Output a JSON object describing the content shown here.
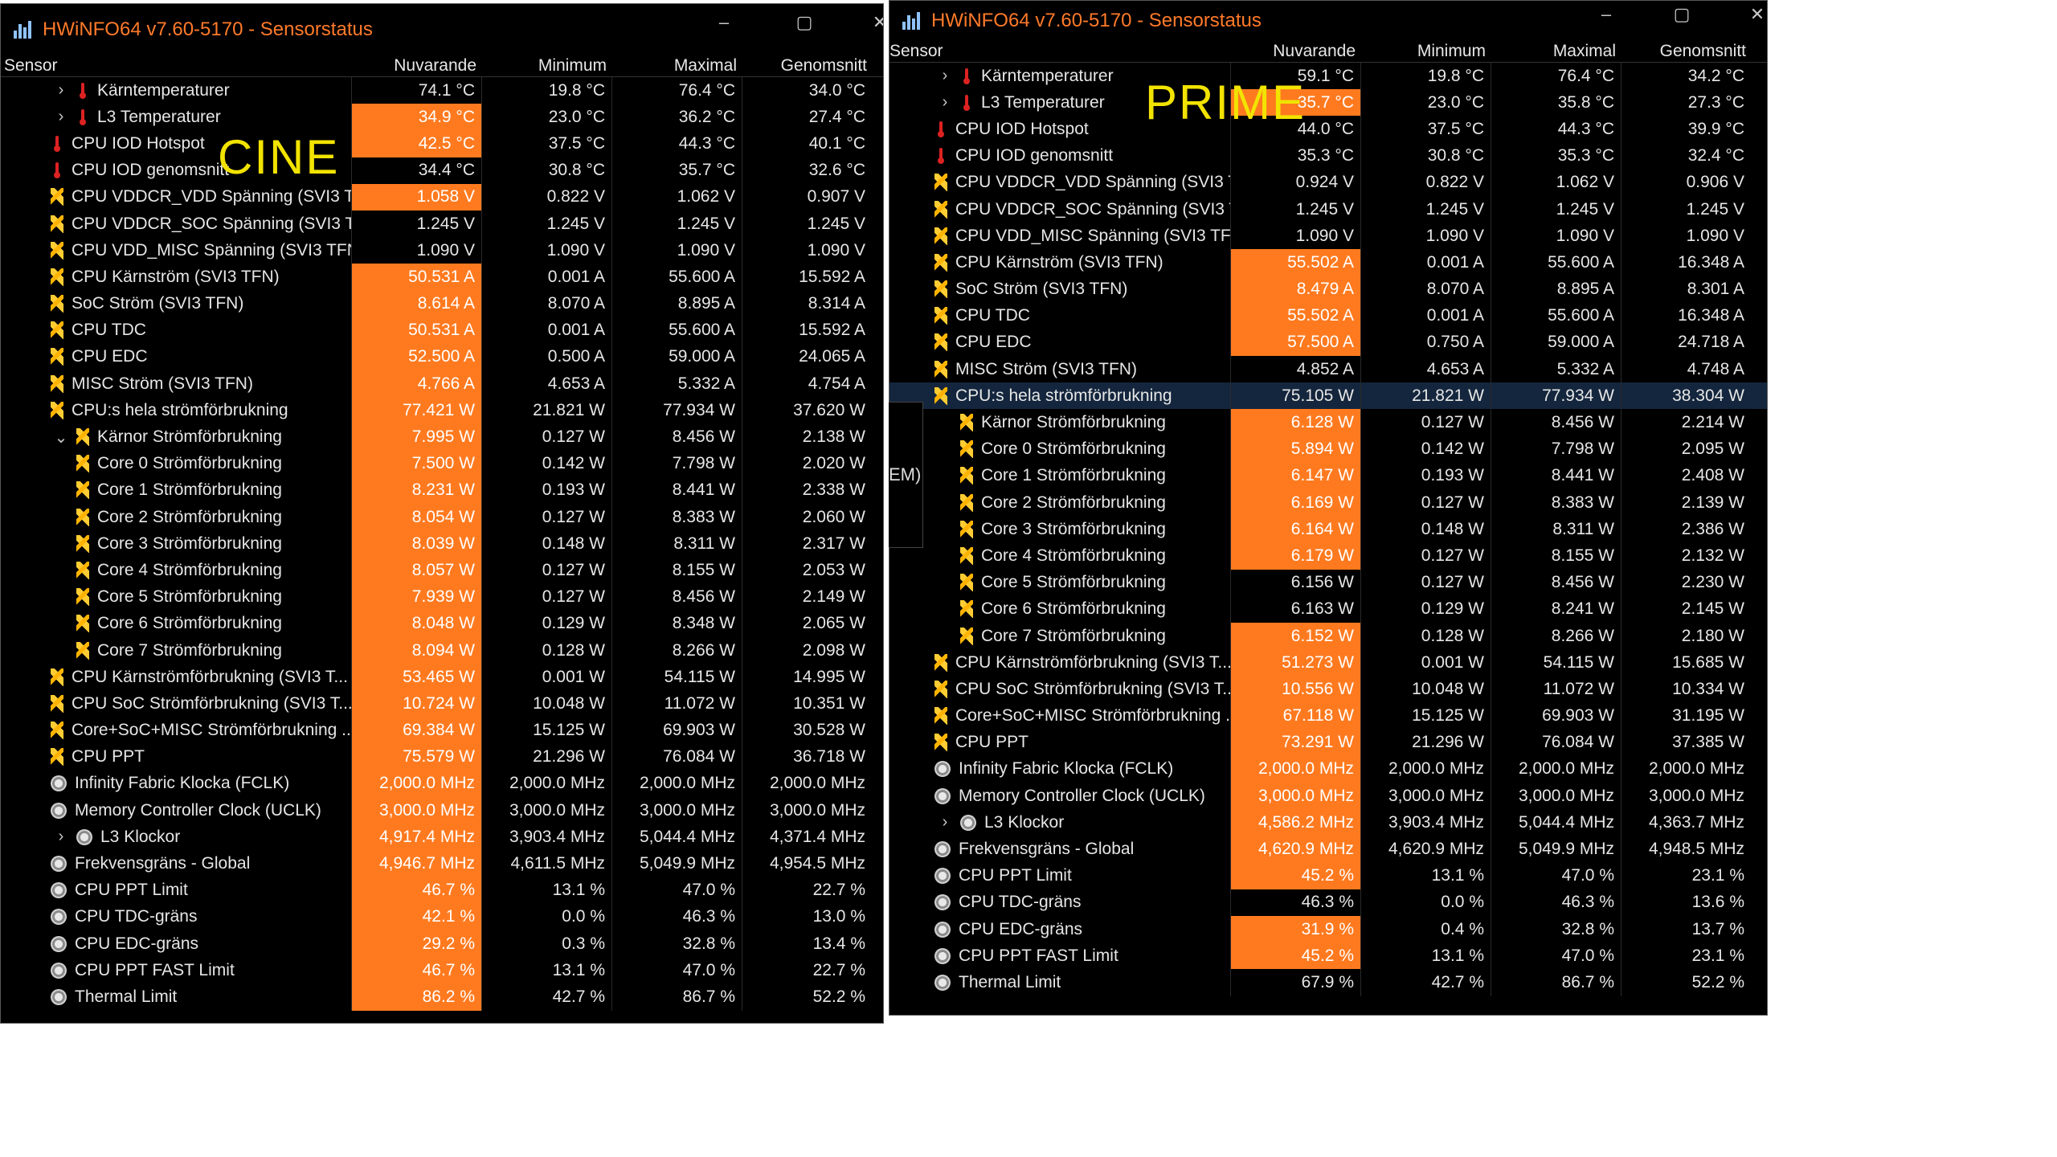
{
  "left": {
    "title": "HWiNFO64 v7.60-5170 - Sensorstatus",
    "overlay": "CINE",
    "headers": [
      "Sensor",
      "Nuvarande",
      "Minimum",
      "Maximal",
      "Genomsnitt"
    ],
    "rows": [
      {
        "n": "Kärntemperaturer",
        "i": "temp",
        "l": 1,
        "ch": ">",
        "v": [
          "74.1 °C",
          "19.8 °C",
          "76.4 °C",
          "34.0 °C"
        ],
        "h": false
      },
      {
        "n": "L3 Temperaturer",
        "i": "temp",
        "l": 1,
        "ch": ">",
        "v": [
          "34.9 °C",
          "23.0 °C",
          "36.2 °C",
          "27.4 °C"
        ],
        "h": true
      },
      {
        "n": "CPU IOD Hotspot",
        "i": "temp",
        "l": 0,
        "v": [
          "42.5 °C",
          "37.5 °C",
          "44.3 °C",
          "40.1 °C"
        ],
        "h": true
      },
      {
        "n": "CPU IOD genomsnitt",
        "i": "temp",
        "l": 0,
        "v": [
          "34.4 °C",
          "30.8 °C",
          "35.7 °C",
          "32.6 °C"
        ],
        "h": false
      },
      {
        "n": "CPU VDDCR_VDD Spänning (SVI3 T...",
        "i": "bolt",
        "l": 0,
        "v": [
          "1.058 V",
          "0.822 V",
          "1.062 V",
          "0.907 V"
        ],
        "h": true
      },
      {
        "n": "CPU VDDCR_SOC Spänning (SVI3 T...",
        "i": "bolt",
        "l": 0,
        "v": [
          "1.245 V",
          "1.245 V",
          "1.245 V",
          "1.245 V"
        ],
        "h": false
      },
      {
        "n": "CPU VDD_MISC Spänning (SVI3 TFN)",
        "i": "bolt",
        "l": 0,
        "v": [
          "1.090 V",
          "1.090 V",
          "1.090 V",
          "1.090 V"
        ],
        "h": false
      },
      {
        "n": "CPU Kärnström (SVI3 TFN)",
        "i": "bolt",
        "l": 0,
        "v": [
          "50.531 A",
          "0.001 A",
          "55.600 A",
          "15.592 A"
        ],
        "h": true
      },
      {
        "n": "SoC Ström (SVI3 TFN)",
        "i": "bolt",
        "l": 0,
        "v": [
          "8.614 A",
          "8.070 A",
          "8.895 A",
          "8.314 A"
        ],
        "h": true
      },
      {
        "n": "CPU TDC",
        "i": "bolt",
        "l": 0,
        "v": [
          "50.531 A",
          "0.001 A",
          "55.600 A",
          "15.592 A"
        ],
        "h": true
      },
      {
        "n": "CPU EDC",
        "i": "bolt",
        "l": 0,
        "v": [
          "52.500 A",
          "0.500 A",
          "59.000 A",
          "24.065 A"
        ],
        "h": true
      },
      {
        "n": "MISC Ström (SVI3 TFN)",
        "i": "bolt",
        "l": 0,
        "v": [
          "4.766 A",
          "4.653 A",
          "5.332 A",
          "4.754 A"
        ],
        "h": true
      },
      {
        "n": "CPU:s hela strömförbrukning",
        "i": "bolt",
        "l": 0,
        "v": [
          "77.421 W",
          "21.821 W",
          "77.934 W",
          "37.620 W"
        ],
        "h": true
      },
      {
        "n": "Kärnor Strömförbrukning",
        "i": "bolt",
        "l": 1,
        "ch": "v",
        "v": [
          "7.995 W",
          "0.127 W",
          "8.456 W",
          "2.138 W"
        ],
        "h": true
      },
      {
        "n": "Core 0 Strömförbrukning",
        "i": "bolt",
        "l": 1,
        "v": [
          "7.500 W",
          "0.142 W",
          "7.798 W",
          "2.020 W"
        ],
        "h": true
      },
      {
        "n": "Core 1 Strömförbrukning",
        "i": "bolt",
        "l": 1,
        "v": [
          "8.231 W",
          "0.193 W",
          "8.441 W",
          "2.338 W"
        ],
        "h": true
      },
      {
        "n": "Core 2 Strömförbrukning",
        "i": "bolt",
        "l": 1,
        "v": [
          "8.054 W",
          "0.127 W",
          "8.383 W",
          "2.060 W"
        ],
        "h": true
      },
      {
        "n": "Core 3 Strömförbrukning",
        "i": "bolt",
        "l": 1,
        "v": [
          "8.039 W",
          "0.148 W",
          "8.311 W",
          "2.317 W"
        ],
        "h": true
      },
      {
        "n": "Core 4 Strömförbrukning",
        "i": "bolt",
        "l": 1,
        "v": [
          "8.057 W",
          "0.127 W",
          "8.155 W",
          "2.053 W"
        ],
        "h": true
      },
      {
        "n": "Core 5 Strömförbrukning",
        "i": "bolt",
        "l": 1,
        "v": [
          "7.939 W",
          "0.127 W",
          "8.456 W",
          "2.149 W"
        ],
        "h": true
      },
      {
        "n": "Core 6 Strömförbrukning",
        "i": "bolt",
        "l": 1,
        "v": [
          "8.048 W",
          "0.129 W",
          "8.348 W",
          "2.065 W"
        ],
        "h": true
      },
      {
        "n": "Core 7 Strömförbrukning",
        "i": "bolt",
        "l": 1,
        "v": [
          "8.094 W",
          "0.128 W",
          "8.266 W",
          "2.098 W"
        ],
        "h": true
      },
      {
        "n": "CPU Kärnströmförbrukning (SVI3 T...",
        "i": "bolt",
        "l": 0,
        "v": [
          "53.465 W",
          "0.001 W",
          "54.115 W",
          "14.995 W"
        ],
        "h": true
      },
      {
        "n": "CPU SoC Strömförbrukning (SVI3 T...",
        "i": "bolt",
        "l": 0,
        "v": [
          "10.724 W",
          "10.048 W",
          "11.072 W",
          "10.351 W"
        ],
        "h": true
      },
      {
        "n": "Core+SoC+MISC Strömförbrukning ...",
        "i": "bolt",
        "l": 0,
        "v": [
          "69.384 W",
          "15.125 W",
          "69.903 W",
          "30.528 W"
        ],
        "h": true
      },
      {
        "n": "CPU PPT",
        "i": "bolt",
        "l": 0,
        "v": [
          "75.579 W",
          "21.296 W",
          "76.084 W",
          "36.718 W"
        ],
        "h": true
      },
      {
        "n": "Infinity Fabric Klocka (FCLK)",
        "i": "clock",
        "l": 0,
        "v": [
          "2,000.0 MHz",
          "2,000.0 MHz",
          "2,000.0 MHz",
          "2,000.0 MHz"
        ],
        "h": true
      },
      {
        "n": "Memory Controller Clock (UCLK)",
        "i": "clock",
        "l": 0,
        "v": [
          "3,000.0 MHz",
          "3,000.0 MHz",
          "3,000.0 MHz",
          "3,000.0 MHz"
        ],
        "h": true
      },
      {
        "n": "L3 Klockor",
        "i": "clock",
        "l": 1,
        "ch": ">",
        "v": [
          "4,917.4 MHz",
          "3,903.4 MHz",
          "5,044.4 MHz",
          "4,371.4 MHz"
        ],
        "h": true
      },
      {
        "n": "Frekvensgräns - Global",
        "i": "clock",
        "l": 0,
        "v": [
          "4,946.7 MHz",
          "4,611.5 MHz",
          "5,049.9 MHz",
          "4,954.5 MHz"
        ],
        "h": true
      },
      {
        "n": "CPU PPT Limit",
        "i": "clock",
        "l": 0,
        "v": [
          "46.7 %",
          "13.1 %",
          "47.0 %",
          "22.7 %"
        ],
        "h": true
      },
      {
        "n": "CPU TDC-gräns",
        "i": "clock",
        "l": 0,
        "v": [
          "42.1 %",
          "0.0 %",
          "46.3 %",
          "13.0 %"
        ],
        "h": true
      },
      {
        "n": "CPU EDC-gräns",
        "i": "clock",
        "l": 0,
        "v": [
          "29.2 %",
          "0.3 %",
          "32.8 %",
          "13.4 %"
        ],
        "h": true
      },
      {
        "n": "CPU PPT FAST Limit",
        "i": "clock",
        "l": 0,
        "v": [
          "46.7 %",
          "13.1 %",
          "47.0 %",
          "22.7 %"
        ],
        "h": true
      },
      {
        "n": "Thermal Limit",
        "i": "clock",
        "l": 0,
        "v": [
          "86.2 %",
          "42.7 %",
          "86.7 %",
          "52.2 %"
        ],
        "h": true
      }
    ]
  },
  "right": {
    "title": "HWiNFO64 v7.60-5170 - Sensorstatus",
    "overlay": "PRIME",
    "side_tab": "EM)",
    "headers": [
      "Sensor",
      "Nuvarande",
      "Minimum",
      "Maximal",
      "Genomsnitt"
    ],
    "rows": [
      {
        "n": "Kärntemperaturer",
        "i": "temp",
        "l": 1,
        "ch": ">",
        "v": [
          "59.1 °C",
          "19.8 °C",
          "76.4 °C",
          "34.2 °C"
        ],
        "h": false
      },
      {
        "n": "L3 Temperaturer",
        "i": "temp",
        "l": 1,
        "ch": ">",
        "v": [
          "35.7 °C",
          "23.0 °C",
          "35.8 °C",
          "27.3 °C"
        ],
        "h": true
      },
      {
        "n": "CPU IOD Hotspot",
        "i": "temp",
        "l": 0,
        "v": [
          "44.0 °C",
          "37.5 °C",
          "44.3 °C",
          "39.9 °C"
        ],
        "h": false
      },
      {
        "n": "CPU IOD genomsnitt",
        "i": "temp",
        "l": 0,
        "v": [
          "35.3 °C",
          "30.8 °C",
          "35.3 °C",
          "32.4 °C"
        ],
        "h": false
      },
      {
        "n": "CPU VDDCR_VDD Spänning (SVI3 T...",
        "i": "bolt",
        "l": 0,
        "v": [
          "0.924 V",
          "0.822 V",
          "1.062 V",
          "0.906 V"
        ],
        "h": false
      },
      {
        "n": "CPU VDDCR_SOC Spänning (SVI3 T...",
        "i": "bolt",
        "l": 0,
        "v": [
          "1.245 V",
          "1.245 V",
          "1.245 V",
          "1.245 V"
        ],
        "h": false
      },
      {
        "n": "CPU VDD_MISC Spänning (SVI3 TFN)",
        "i": "bolt",
        "l": 0,
        "v": [
          "1.090 V",
          "1.090 V",
          "1.090 V",
          "1.090 V"
        ],
        "h": false
      },
      {
        "n": "CPU Kärnström (SVI3 TFN)",
        "i": "bolt",
        "l": 0,
        "v": [
          "55.502 A",
          "0.001 A",
          "55.600 A",
          "16.348 A"
        ],
        "h": true
      },
      {
        "n": "SoC Ström (SVI3 TFN)",
        "i": "bolt",
        "l": 0,
        "v": [
          "8.479 A",
          "8.070 A",
          "8.895 A",
          "8.301 A"
        ],
        "h": true
      },
      {
        "n": "CPU TDC",
        "i": "bolt",
        "l": 0,
        "v": [
          "55.502 A",
          "0.001 A",
          "55.600 A",
          "16.348 A"
        ],
        "h": true
      },
      {
        "n": "CPU EDC",
        "i": "bolt",
        "l": 0,
        "v": [
          "57.500 A",
          "0.750 A",
          "59.000 A",
          "24.718 A"
        ],
        "h": true
      },
      {
        "n": "MISC Ström (SVI3 TFN)",
        "i": "bolt",
        "l": 0,
        "v": [
          "4.852 A",
          "4.653 A",
          "5.332 A",
          "4.748 A"
        ],
        "h": false
      },
      {
        "n": "CPU:s hela strömförbrukning",
        "i": "bolt",
        "l": 0,
        "v": [
          "75.105 W",
          "21.821 W",
          "77.934 W",
          "38.304 W"
        ],
        "h": false,
        "sel": true
      },
      {
        "n": "Kärnor Strömförbrukning",
        "i": "bolt",
        "l": 1,
        "v": [
          "6.128 W",
          "0.127 W",
          "8.456 W",
          "2.214 W"
        ],
        "h": true
      },
      {
        "n": "Core 0 Strömförbrukning",
        "i": "bolt",
        "l": 1,
        "v": [
          "5.894 W",
          "0.142 W",
          "7.798 W",
          "2.095 W"
        ],
        "h": true
      },
      {
        "n": "Core 1 Strömförbrukning",
        "i": "bolt",
        "l": 1,
        "v": [
          "6.147 W",
          "0.193 W",
          "8.441 W",
          "2.408 W"
        ],
        "h": true
      },
      {
        "n": "Core 2 Strömförbrukning",
        "i": "bolt",
        "l": 1,
        "v": [
          "6.169 W",
          "0.127 W",
          "8.383 W",
          "2.139 W"
        ],
        "h": true
      },
      {
        "n": "Core 3 Strömförbrukning",
        "i": "bolt",
        "l": 1,
        "v": [
          "6.164 W",
          "0.148 W",
          "8.311 W",
          "2.386 W"
        ],
        "h": true
      },
      {
        "n": "Core 4 Strömförbrukning",
        "i": "bolt",
        "l": 1,
        "v": [
          "6.179 W",
          "0.127 W",
          "8.155 W",
          "2.132 W"
        ],
        "h": true
      },
      {
        "n": "Core 5 Strömförbrukning",
        "i": "bolt",
        "l": 1,
        "v": [
          "6.156 W",
          "0.127 W",
          "8.456 W",
          "2.230 W"
        ],
        "h": false
      },
      {
        "n": "Core 6 Strömförbrukning",
        "i": "bolt",
        "l": 1,
        "v": [
          "6.163 W",
          "0.129 W",
          "8.241 W",
          "2.145 W"
        ],
        "h": false
      },
      {
        "n": "Core 7 Strömförbrukning",
        "i": "bolt",
        "l": 1,
        "v": [
          "6.152 W",
          "0.128 W",
          "8.266 W",
          "2.180 W"
        ],
        "h": true
      },
      {
        "n": "CPU Kärnströmförbrukning (SVI3 T...",
        "i": "bolt",
        "l": 0,
        "v": [
          "51.273 W",
          "0.001 W",
          "54.115 W",
          "15.685 W"
        ],
        "h": true
      },
      {
        "n": "CPU SoC Strömförbrukning (SVI3 T...",
        "i": "bolt",
        "l": 0,
        "v": [
          "10.556 W",
          "10.048 W",
          "11.072 W",
          "10.334 W"
        ],
        "h": true
      },
      {
        "n": "Core+SoC+MISC Strömförbrukning ...",
        "i": "bolt",
        "l": 0,
        "v": [
          "67.118 W",
          "15.125 W",
          "69.903 W",
          "31.195 W"
        ],
        "h": true
      },
      {
        "n": "CPU PPT",
        "i": "bolt",
        "l": 0,
        "v": [
          "73.291 W",
          "21.296 W",
          "76.084 W",
          "37.385 W"
        ],
        "h": true
      },
      {
        "n": "Infinity Fabric Klocka (FCLK)",
        "i": "clock",
        "l": 0,
        "v": [
          "2,000.0 MHz",
          "2,000.0 MHz",
          "2,000.0 MHz",
          "2,000.0 MHz"
        ],
        "h": true
      },
      {
        "n": "Memory Controller Clock (UCLK)",
        "i": "clock",
        "l": 0,
        "v": [
          "3,000.0 MHz",
          "3,000.0 MHz",
          "3,000.0 MHz",
          "3,000.0 MHz"
        ],
        "h": true
      },
      {
        "n": "L3 Klockor",
        "i": "clock",
        "l": 1,
        "ch": ">",
        "v": [
          "4,586.2 MHz",
          "3,903.4 MHz",
          "5,044.4 MHz",
          "4,363.7 MHz"
        ],
        "h": true
      },
      {
        "n": "Frekvensgräns - Global",
        "i": "clock",
        "l": 0,
        "v": [
          "4,620.9 MHz",
          "4,620.9 MHz",
          "5,049.9 MHz",
          "4,948.5 MHz"
        ],
        "h": true
      },
      {
        "n": "CPU PPT Limit",
        "i": "clock",
        "l": 0,
        "v": [
          "45.2 %",
          "13.1 %",
          "47.0 %",
          "23.1 %"
        ],
        "h": true
      },
      {
        "n": "CPU TDC-gräns",
        "i": "clock",
        "l": 0,
        "v": [
          "46.3 %",
          "0.0 %",
          "46.3 %",
          "13.6 %"
        ],
        "h": false
      },
      {
        "n": "CPU EDC-gräns",
        "i": "clock",
        "l": 0,
        "v": [
          "31.9 %",
          "0.4 %",
          "32.8 %",
          "13.7 %"
        ],
        "h": true
      },
      {
        "n": "CPU PPT FAST Limit",
        "i": "clock",
        "l": 0,
        "v": [
          "45.2 %",
          "13.1 %",
          "47.0 %",
          "23.1 %"
        ],
        "h": true
      },
      {
        "n": "Thermal Limit",
        "i": "clock",
        "l": 0,
        "v": [
          "67.9 %",
          "42.7 %",
          "86.7 %",
          "52.2 %"
        ],
        "h": false
      }
    ]
  },
  "window_controls": {
    "minimize": "–",
    "maximize": "▢",
    "close": "✕"
  },
  "colors": {
    "highlight": "#ff7a1f",
    "title": "#ff7a2a",
    "overlay_text": "#f2e300",
    "background": "#000000"
  }
}
